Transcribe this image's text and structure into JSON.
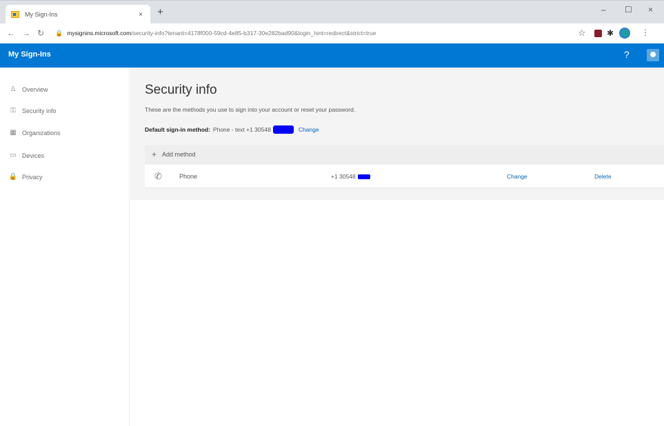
{
  "browser": {
    "tab_title": "My Sign-Ins",
    "tab_close": "×",
    "new_tab": "+",
    "url_host": "mysignins.microsoft.com",
    "url_rest": "/security-info?tenant=4178f000-59cd-4e85-b317-30e282bad90&login_hint=redirect&strict=true",
    "window_minimize": "–",
    "window_maximize": "☐",
    "window_close": "×"
  },
  "app": {
    "title": "My Sign-Ins",
    "help": "?"
  },
  "sidebar": {
    "items": [
      {
        "icon": "person-icon",
        "glyph": "♙",
        "label": "Overview"
      },
      {
        "icon": "key-icon",
        "glyph": "⚿",
        "label": "Security info"
      },
      {
        "icon": "organization-icon",
        "glyph": "▦",
        "label": "Organizations"
      },
      {
        "icon": "devices-icon",
        "glyph": "▭",
        "label": "Devices"
      },
      {
        "icon": "lock-icon",
        "glyph": "🔒",
        "label": "Privacy"
      }
    ]
  },
  "main": {
    "title": "Security info",
    "description": "These are the methods you use to sign into your account or reset your password.",
    "default_label": "Default sign-in method:",
    "default_value": "Phone - text +1 30548",
    "default_change": "Change",
    "add_method": "Add method",
    "methods": [
      {
        "icon": "phone-icon",
        "name": "Phone",
        "value": "+1 30548",
        "change": "Change",
        "delete": "Delete"
      }
    ]
  },
  "colors": {
    "accent": "#0078d4",
    "link": "#0067b8",
    "redaction": "#0000ff"
  }
}
